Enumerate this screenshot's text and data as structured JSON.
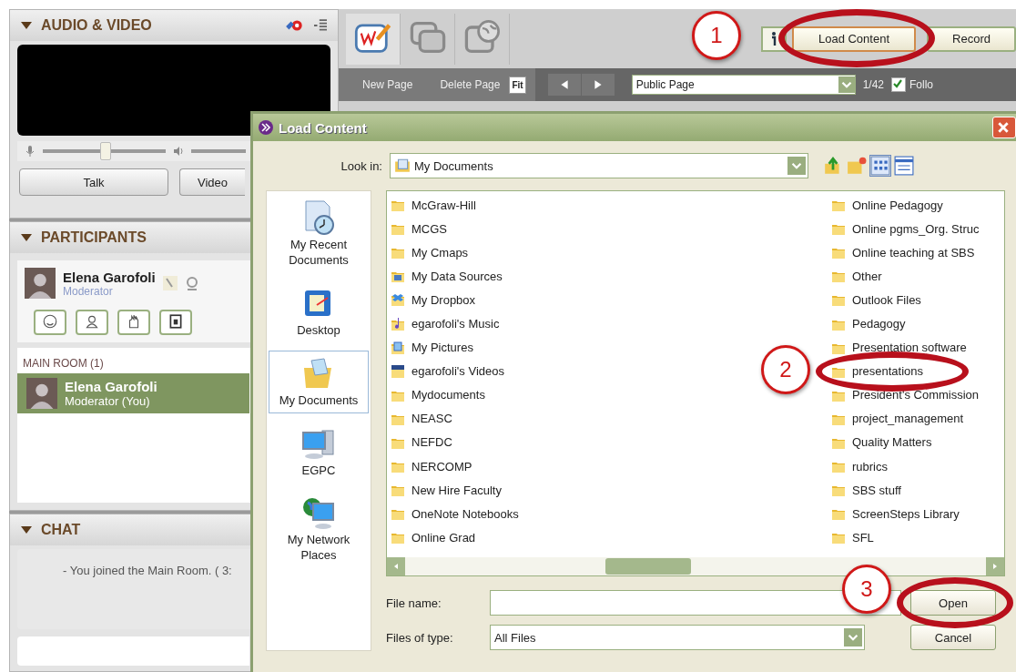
{
  "audio_video": {
    "title": "AUDIO & VIDEO",
    "mic": {
      "level": 0.5
    },
    "buttons": [
      "Talk",
      "Video"
    ]
  },
  "participants": {
    "title": "PARTICIPANTS",
    "me": {
      "name": "Elena Garofoli",
      "role": "Moderator"
    },
    "room": "MAIN ROOM (1)",
    "list": [
      {
        "name": "Elena Garofoli",
        "role": "Moderator (You)",
        "selected": true
      }
    ]
  },
  "chat": {
    "title": "CHAT",
    "messages": [
      "- You joined the Main Room. ( 3:"
    ]
  },
  "toolbar": {
    "tools": [
      {
        "kind": "whiteboard",
        "selected": true
      },
      {
        "kind": "application",
        "selected": false
      },
      {
        "kind": "web",
        "selected": false
      }
    ],
    "buttons": [
      "Load Content",
      "Record"
    ]
  },
  "page_bar": {
    "actions": [
      "New Page",
      "Delete Page"
    ],
    "fit": "Fit",
    "page": "Public Page",
    "count": "1/42",
    "follow": {
      "label": "Follo",
      "checked": true
    }
  },
  "dialog": {
    "title": "Load Content",
    "look_in_label": "Look in:",
    "look_in": "My Documents",
    "places": [
      {
        "label": "My Recent Documents",
        "kind": "recent",
        "selected": false
      },
      {
        "label": "Desktop",
        "kind": "desktop",
        "selected": false
      },
      {
        "label": "My Documents",
        "kind": "documents",
        "selected": true
      },
      {
        "label": "EGPC",
        "kind": "computer",
        "selected": false
      },
      {
        "label": "My Network Places",
        "kind": "network",
        "selected": false
      }
    ],
    "files": [
      {
        "name": "McGraw-Hill",
        "kind": "folder"
      },
      {
        "name": "MCGS",
        "kind": "folder"
      },
      {
        "name": "My Cmaps",
        "kind": "folder"
      },
      {
        "name": "My Data Sources",
        "kind": "data"
      },
      {
        "name": "My Dropbox",
        "kind": "dropbox"
      },
      {
        "name": "egarofoli's Music",
        "kind": "music"
      },
      {
        "name": "My Pictures",
        "kind": "pictures"
      },
      {
        "name": "egarofoli's Videos",
        "kind": "videos"
      },
      {
        "name": "Mydocuments",
        "kind": "folder"
      },
      {
        "name": "NEASC",
        "kind": "folder"
      },
      {
        "name": "NEFDC",
        "kind": "folder"
      },
      {
        "name": "NERCOMP",
        "kind": "folder"
      },
      {
        "name": "New Hire Faculty",
        "kind": "folder"
      },
      {
        "name": "OneNote Notebooks",
        "kind": "folder"
      },
      {
        "name": "Online Grad",
        "kind": "folder"
      },
      {
        "name": "Online Pedagogy",
        "kind": "folder"
      },
      {
        "name": "Online pgms_Org. Struc",
        "kind": "folder"
      },
      {
        "name": "Online teaching at SBS",
        "kind": "folder"
      },
      {
        "name": "Other",
        "kind": "folder"
      },
      {
        "name": "Outlook Files",
        "kind": "folder"
      },
      {
        "name": "Pedagogy",
        "kind": "folder"
      },
      {
        "name": "Presentation software",
        "kind": "folder"
      },
      {
        "name": "presentations",
        "kind": "folder"
      },
      {
        "name": "President's Commission",
        "kind": "folder"
      },
      {
        "name": "project_management",
        "kind": "folder"
      },
      {
        "name": "Quality Matters",
        "kind": "folder"
      },
      {
        "name": "rubrics",
        "kind": "folder"
      },
      {
        "name": "SBS stuff",
        "kind": "folder"
      },
      {
        "name": "ScreenSteps Library",
        "kind": "folder"
      },
      {
        "name": "SFL",
        "kind": "folder"
      }
    ],
    "file_name_label": "File name:",
    "file_type_label": "Files of type:",
    "file_type": "All Files",
    "buttons": [
      "Open",
      "Cancel"
    ]
  },
  "annotations": [
    "1",
    "2",
    "3"
  ]
}
